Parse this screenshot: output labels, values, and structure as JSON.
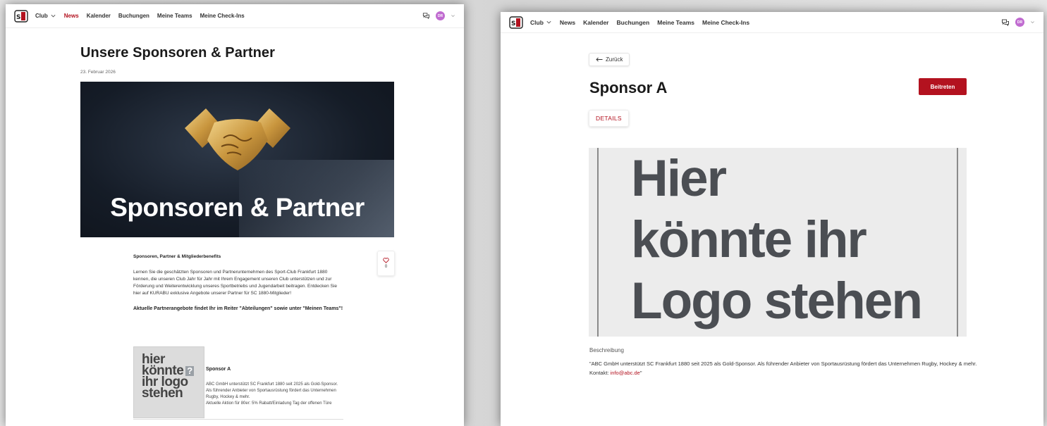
{
  "left_window": {
    "nav": {
      "logo_text": "SC",
      "club_label": "Club",
      "news_label": "News",
      "kalender_label": "Kalender",
      "buchungen_label": "Buchungen",
      "teams_label": "Meine Teams",
      "checkins_label": "Meine Check-Ins",
      "avatar_initials": "DR"
    },
    "article": {
      "title": "Unsere Sponsoren & Partner",
      "date": "23. Februar 2026",
      "hero_text": "Sponsoren & Partner",
      "heading": "Sponsoren, Partner & Mitgliederbenefits",
      "paragraph": "Lernen Sie die geschätzten Sponsoren und Partnerunternehmen des Sport-Club Frankfurt 1880 kennen, die unseren Club Jahr für Jahr mit Ihrem Engagement unseren Club unterstützen und zur Förderung und Weiterentwicklung unseres Sportbetriebs und Jugendarbeit beitragen. Entdecken Sie hier auf KURABU exklusive Angebote unserer Partner für SC 1880-Mitglieder!",
      "subheading": "Aktuelle Partnerangebote findet Ihr im Reiter \"Abteilungen\" sowie unter \"Meinen Teams\"!",
      "like_count": "0"
    },
    "sponsor_card": {
      "image_line1": "hier",
      "image_line2": "könnte",
      "image_q": "?",
      "image_line3": "ihr logo",
      "image_line4": "stehen",
      "title": "Sponsor A",
      "text1": "ABC GmbH unterstützt SC Frankfurt 1880 seit 2025 als Gold-Sponsor. Als führender Anbieter von Sportausrüstung fördert das Unternehmen Rugby, Hockey & mehr.",
      "text2": "Aktuelle Aktion für 80er: 5% Rabatt/Einladung Tag der offenen Türe"
    }
  },
  "right_window": {
    "nav": {
      "logo_text": "SC",
      "club_label": "Club",
      "news_label": "News",
      "kalender_label": "Kalender",
      "buchungen_label": "Buchungen",
      "teams_label": "Meine Teams",
      "checkins_label": "Meine Check-Ins",
      "avatar_initials": "DR"
    },
    "back_label": "Zurück",
    "title": "Sponsor A",
    "join_label": "Beitreten",
    "tab_details": "DETAILS",
    "logo_line1": "Hier",
    "logo_line2": "könnte ihr",
    "logo_line3": "Logo stehen",
    "description_label": "Beschreibung",
    "description_text": "\"ABC GmbH unterstützt SC Frankfurt 1880 seit 2025 als Gold-Sponsor. Als führender Anbieter von Sportausrüstung fördert das Unternehmen Rugby, Hockey & mehr. Kontakt: ",
    "description_link": "info@abc.de",
    "description_end": "\""
  },
  "colors": {
    "accent": "#b3121f",
    "avatar": "#c06bd0"
  }
}
